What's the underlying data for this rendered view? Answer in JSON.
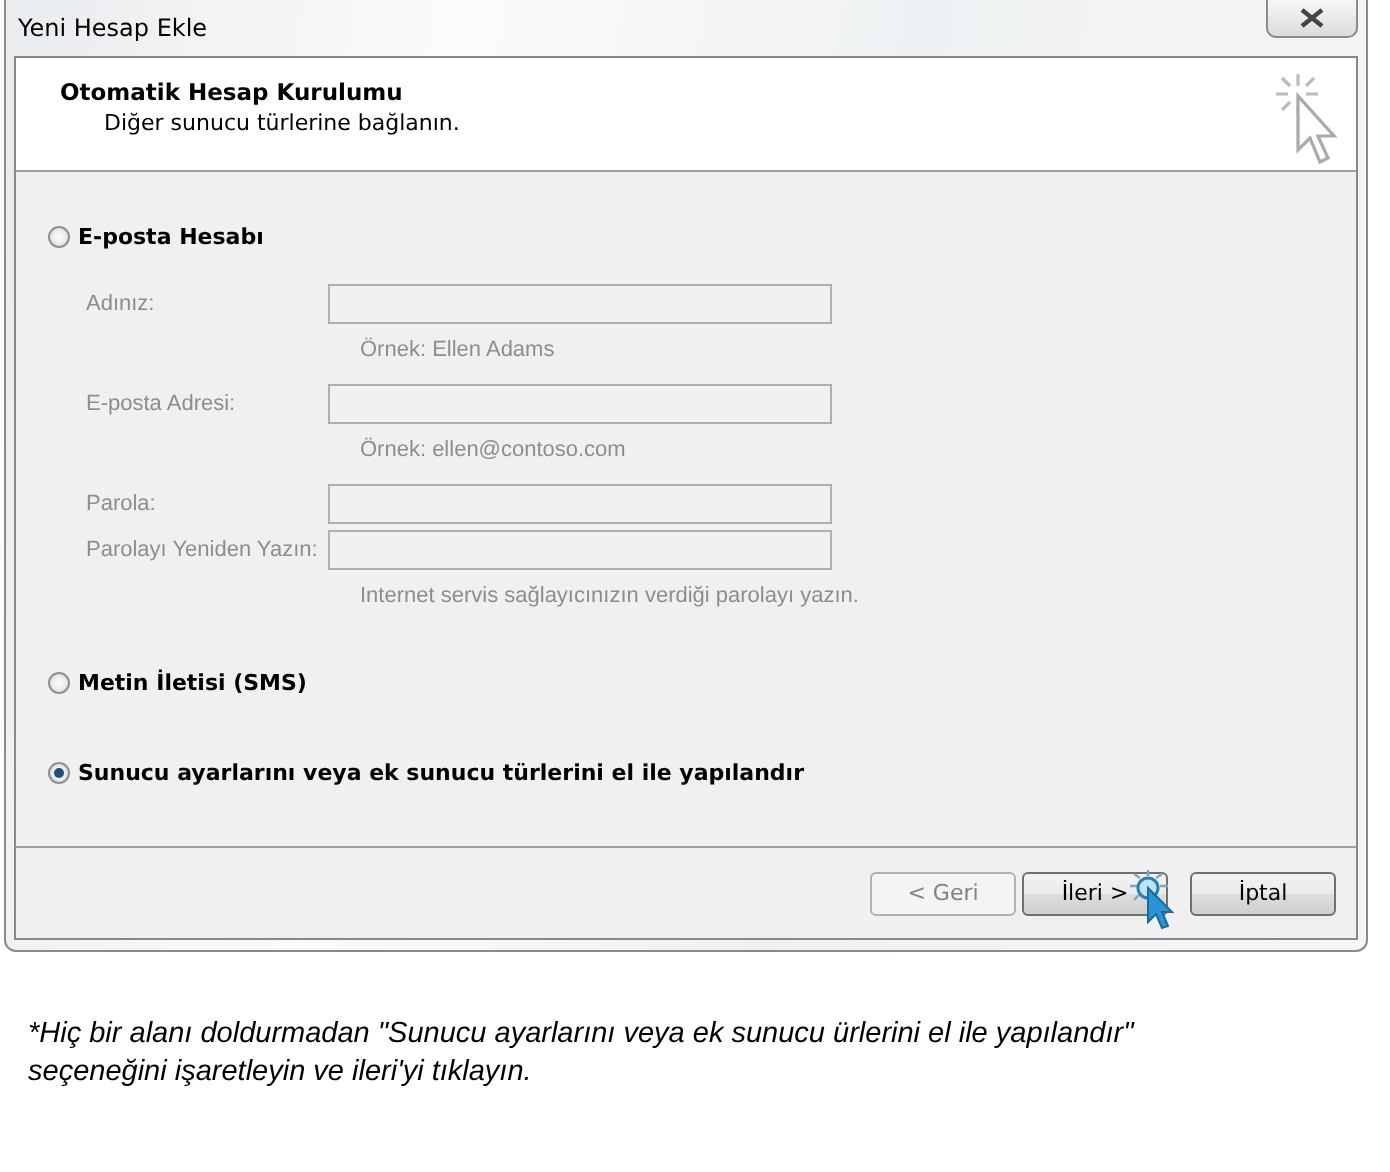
{
  "window": {
    "title": "Yeni Hesap Ekle"
  },
  "header": {
    "title": "Otomatik Hesap Kurulumu",
    "subtitle": "Diğer sunucu türlerine bağlanın."
  },
  "options": [
    {
      "label": "E-posta Hesabı",
      "selected": false,
      "fields": [
        {
          "label": "Adınız:",
          "disabled": true,
          "hint": "Örnek: Ellen Adams"
        },
        {
          "label": "E-posta Adresi:",
          "disabled": true,
          "hint": "Örnek: ellen@contoso.com"
        },
        {
          "label": "Parola:",
          "disabled": true
        },
        {
          "label": "Parolayı Yeniden Yazın:",
          "disabled": true,
          "hint": "Internet servis sağlayıcınızın verdiği parolayı yazın."
        }
      ]
    },
    {
      "label": "Metin İletisi (SMS)",
      "selected": false
    },
    {
      "label": "Sunucu ayarlarını veya ek sunucu türlerini el ile yapılandır",
      "selected": true
    }
  ],
  "buttons": [
    {
      "label": "< Geri",
      "disabled": true,
      "pointer": false
    },
    {
      "label": "İleri >",
      "disabled": false,
      "pointer": true
    },
    {
      "label": "İptal",
      "disabled": false,
      "pointer": false
    }
  ],
  "caption": "*Hiç bir alanı doldurmadan \"Sunucu ayarlarını veya ek sunucu ürlerini el ile yapılandır\" seçeneğini işaretleyin ve ileri'yi tıklayın."
}
